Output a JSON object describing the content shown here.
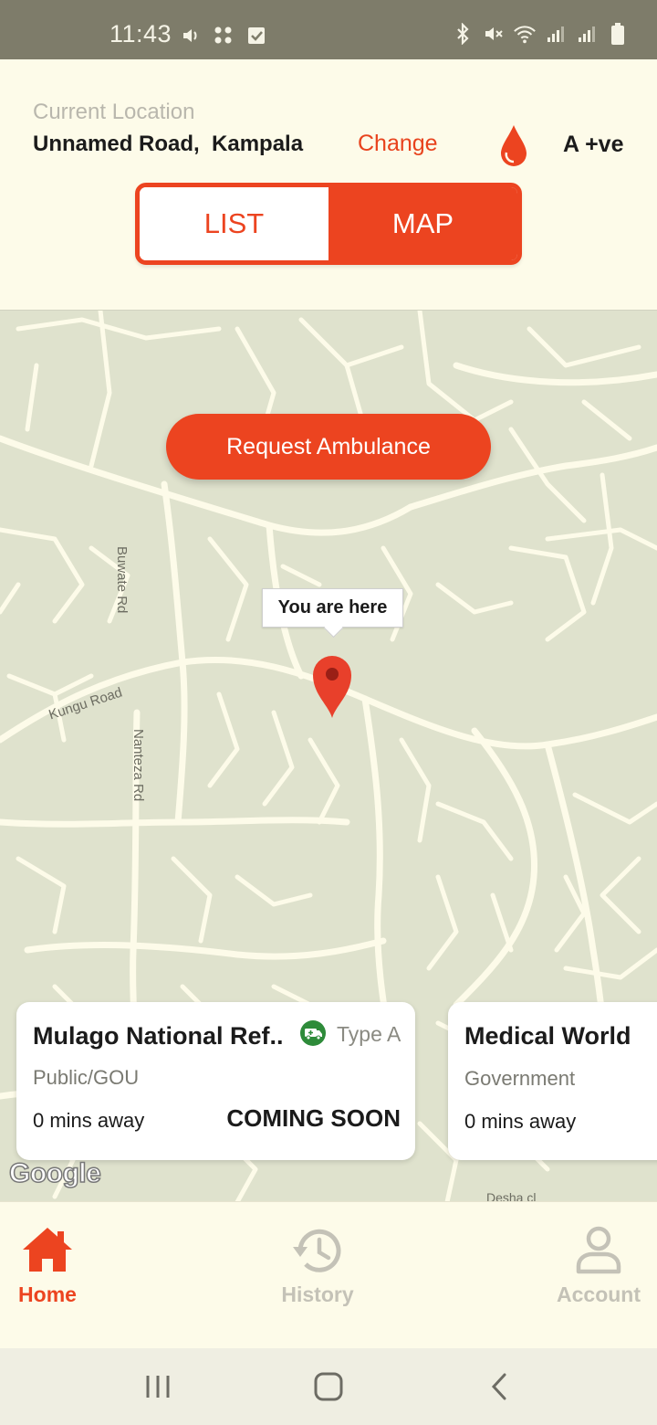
{
  "status_bar": {
    "time": "11:43",
    "left_icons": [
      "volume-icon",
      "dots-grid-icon",
      "check-box-icon"
    ],
    "right_icons": [
      "bluetooth-icon",
      "mute-icon",
      "wifi-icon",
      "signal-icon",
      "signal-icon",
      "battery-icon"
    ]
  },
  "header": {
    "location_caption": "Current Location",
    "location_value": "Unnamed Road,  Kampala",
    "change_label": "Change",
    "blood_type": "A +ve"
  },
  "view_toggle": {
    "list_label": "LIST",
    "map_label": "MAP",
    "selected": "MAP"
  },
  "map": {
    "request_button": "Request Ambulance",
    "tooltip": "You are here",
    "road_labels": {
      "buwate": "Buwate Rd",
      "kungu": "Kungu Road",
      "nanteza": "Nanteza Rd",
      "desha": "Desha cl"
    },
    "attribution": "Google"
  },
  "hospitals": [
    {
      "name": "Mulago National Ref..",
      "category": "Public/GOU",
      "type_label": "Type A",
      "eta": "0 mins away",
      "status": "COMING SOON"
    },
    {
      "name": "Medical World",
      "category": "Government",
      "eta": "0 mins away"
    }
  ],
  "bottom_nav": {
    "home": "Home",
    "history": "History",
    "account": "Account",
    "active": "Home"
  },
  "colors": {
    "accent": "#ec4420",
    "background": "#fdfbe9",
    "map_land": "#dfe2cd",
    "map_road": "#fdfbe9",
    "inactive": "#c4c2b7"
  }
}
